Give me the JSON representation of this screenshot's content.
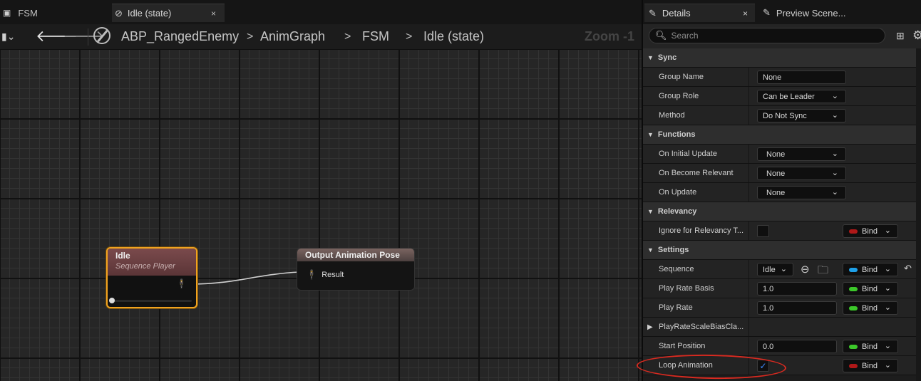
{
  "tabs": {
    "fsm_label": "FSM",
    "idle_label": "Idle (state)",
    "close_glyph": "×"
  },
  "breadcrumb": {
    "asset": "ABP_RangedEnemy",
    "graph": "AnimGraph",
    "fsm": "FSM",
    "state": "Idle (state)",
    "sep": ">",
    "zoom": "Zoom -1"
  },
  "nodes": {
    "idle": {
      "title": "Idle",
      "subtitle": "Sequence Player",
      "progress": 0.0
    },
    "output": {
      "title": "Output Animation Pose",
      "result_label": "Result"
    }
  },
  "details": {
    "tab_details": "Details",
    "tab_preview": "Preview Scene...",
    "search_placeholder": "Search",
    "categories": {
      "sync": "Sync",
      "functions": "Functions",
      "relevancy": "Relevancy",
      "settings": "Settings"
    },
    "sync": {
      "group_name_label": "Group Name",
      "group_name_value": "None",
      "group_role_label": "Group Role",
      "group_role_value": "Can be Leader",
      "method_label": "Method",
      "method_value": "Do Not Sync"
    },
    "functions": {
      "initial_update_label": "On Initial Update",
      "initial_update_value": "None",
      "become_relevant_label": "On Become Relevant",
      "become_relevant_value": "None",
      "update_label": "On Update",
      "update_value": "None"
    },
    "relevancy": {
      "ignore_label": "Ignore for Relevancy T...",
      "ignore_checked": false
    },
    "settings": {
      "sequence_label": "Sequence",
      "sequence_value": "Idle",
      "play_rate_basis_label": "Play Rate Basis",
      "play_rate_basis_value": "1.0",
      "play_rate_label": "Play Rate",
      "play_rate_value": "1.0",
      "scale_bias_label": "PlayRateScaleBiasCla...",
      "start_position_label": "Start Position",
      "start_position_value": "0.0",
      "loop_label": "Loop Animation",
      "loop_checked": true
    },
    "bind_label": "Bind",
    "checkmark": "✓"
  },
  "colors": {
    "node_selected_border": "#f1a31f",
    "bind_dot_red": "#b01818",
    "bind_dot_blue": "#1ea0e8",
    "bind_dot_green": "#3cc82a",
    "annotation_red": "#d82a20"
  }
}
